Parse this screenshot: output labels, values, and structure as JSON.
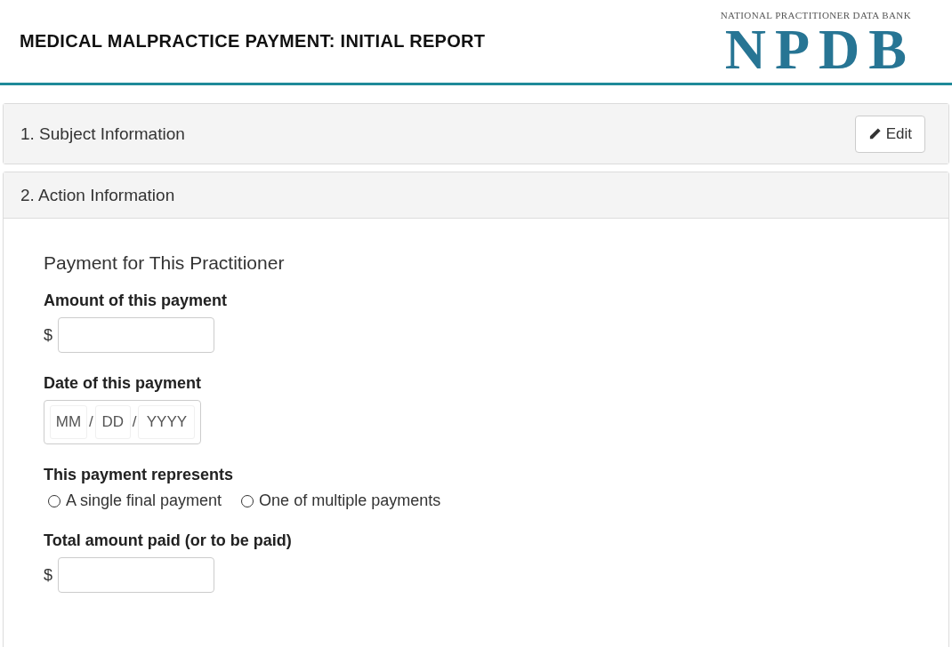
{
  "header": {
    "title": "MEDICAL MALPRACTICE PAYMENT: INITIAL REPORT",
    "logo": {
      "caption": "NATIONAL PRACTITIONER DATA BANK",
      "mark": "NPDB"
    }
  },
  "sections": [
    {
      "title": "1. Subject Information",
      "expanded": false,
      "action": "Edit"
    },
    {
      "title": "2. Action Information",
      "expanded": true
    }
  ],
  "form": {
    "heading": "Payment for This Practitioner",
    "fields": [
      {
        "kind": "currency",
        "label": "Amount of this payment",
        "prefix": "$"
      },
      {
        "kind": "date",
        "label": "Date of this payment",
        "parts": [
          {
            "placeholder": "MM"
          },
          {
            "placeholder": "DD"
          },
          {
            "placeholder": "YYYY"
          }
        ],
        "separators": [
          "/",
          "/"
        ]
      },
      {
        "kind": "radio",
        "label": "This payment represents",
        "options": [
          {
            "label": "A single final payment",
            "selected": false
          },
          {
            "label": "One of multiple payments",
            "selected": false
          }
        ]
      },
      {
        "kind": "currency",
        "label": "Total amount paid (or to be paid)",
        "prefix": "$"
      }
    ]
  }
}
